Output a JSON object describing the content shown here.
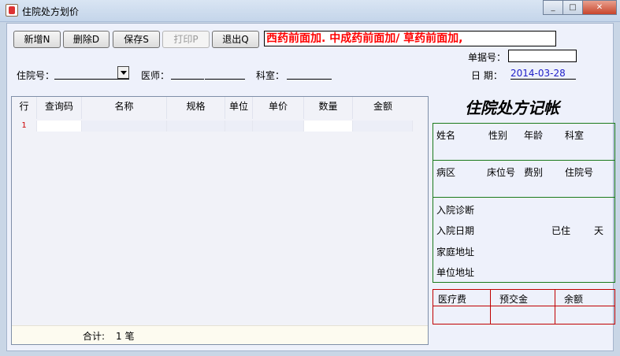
{
  "window": {
    "title": "住院处方划价",
    "min_glyph": "_",
    "max_glyph": "□",
    "close_glyph": "✕"
  },
  "toolbar": {
    "new_label": "新增N",
    "delete_label": "删除D",
    "save_label": "保存S",
    "print_label": "打印P",
    "exit_label": "退出Q"
  },
  "notice": "西药前面加.   中成药前面加/   草药前面加,",
  "form": {
    "inpatient_no_label": "住院号：",
    "inpatient_no_value": "",
    "doctor_label": "医师：",
    "dept_label": "科室：",
    "receipt_no_label": "单据号：",
    "date_label": "日   期：",
    "date_value": "2014-03-28"
  },
  "grid": {
    "columns": [
      "行",
      "查询码",
      "名称",
      "规格",
      "单位",
      "单价",
      "数量",
      "金额"
    ],
    "rows": [
      {
        "row": "1"
      }
    ],
    "footer_total_label": "合计:",
    "footer_count": "1 笔"
  },
  "info_panel": {
    "title": "住院处方记帐",
    "row1": [
      "姓名",
      "性别",
      "年龄",
      "科室"
    ],
    "row2": [
      "病区",
      "床位号",
      "费别",
      "住院号"
    ],
    "diagnosis_label": "入院诊断",
    "admit_date_label": "入院日期",
    "stayed_label": "已住",
    "days_label": "天",
    "home_address_label": "家庭地址",
    "work_address_label": "单位地址"
  },
  "fees": {
    "headers": [
      "医疗费",
      "预交金",
      "余额"
    ]
  },
  "colors": {
    "notice_text": "#ff0000",
    "date_text": "#2020c8",
    "green_border": "#1b7a1b",
    "red_border": "#c00000"
  }
}
